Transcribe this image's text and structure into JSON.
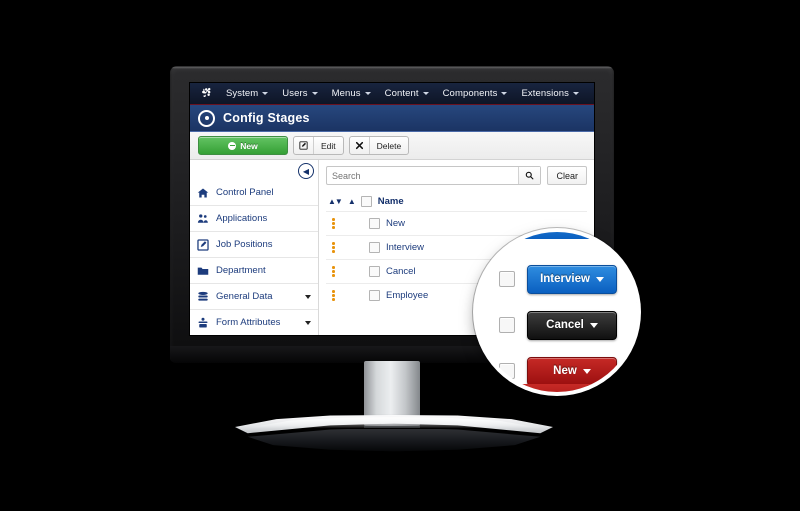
{
  "menubar": {
    "logo_icon": "joomla-logo-icon",
    "items": [
      {
        "label": "System",
        "caret": true
      },
      {
        "label": "Users",
        "caret": true
      },
      {
        "label": "Menus",
        "caret": true
      },
      {
        "label": "Content",
        "caret": true
      },
      {
        "label": "Components",
        "caret": true
      },
      {
        "label": "Extensions",
        "caret": true
      }
    ]
  },
  "titlebar": {
    "icon": "target-circle-icon",
    "title": "Config Stages"
  },
  "toolbar": {
    "new_label": "New",
    "edit_label": "Edit",
    "edit_icon": "pencil-square-icon",
    "delete_label": "Delete",
    "delete_icon": "x-mark-icon"
  },
  "sidebar": {
    "collapse_icon": "arrow-left-circle-icon",
    "items": [
      {
        "label": "Control Panel",
        "icon": "home-icon",
        "caret": false
      },
      {
        "label": "Applications",
        "icon": "people-icon",
        "caret": false
      },
      {
        "label": "Job Positions",
        "icon": "pencil-square-icon",
        "caret": false
      },
      {
        "label": "Department",
        "icon": "folder-icon",
        "caret": false
      },
      {
        "label": "General Data",
        "icon": "database-icon",
        "caret": true
      },
      {
        "label": "Form Attributes",
        "icon": "form-icon",
        "caret": true
      }
    ]
  },
  "search": {
    "value": "",
    "placeholder": "Search",
    "search_icon": "magnifier-icon",
    "clear_label": "Clear"
  },
  "table": {
    "sort_icon": "sort-updown-icon",
    "sort_asc_icon": "sort-asc-icon",
    "header_name": "Name",
    "rows": [
      {
        "name": "New"
      },
      {
        "name": "Interview"
      },
      {
        "name": "Cancel"
      },
      {
        "name": "Employee"
      }
    ]
  },
  "magnifier": {
    "buttons": [
      {
        "label": "Interview",
        "color": "#1568c8",
        "style": "blue"
      },
      {
        "label": "Cancel",
        "color": "#1d1d1d",
        "style": "black"
      },
      {
        "label": "New",
        "color": "#b01a18",
        "style": "red"
      }
    ]
  },
  "colors": {
    "background": "#000000",
    "menubar": "#0e1526",
    "titlebar": "#1b3464",
    "accent_blue": "#1d3c7d",
    "new_green": "#35a035",
    "grip_orange": "#e8930c"
  }
}
